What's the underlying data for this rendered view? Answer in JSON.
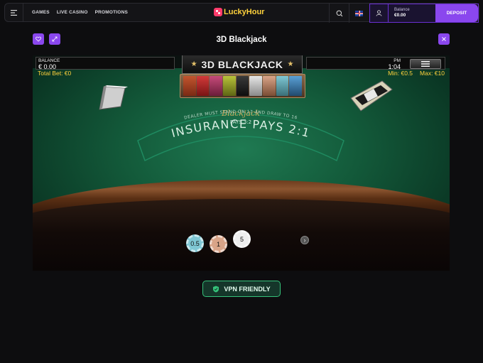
{
  "header": {
    "nav": [
      "GAMES",
      "LIVE CASINO",
      "PROMOTIONS"
    ],
    "logo_text": "LuckyHour",
    "balance_label": "Balance",
    "balance_value": "€0.00",
    "deposit_label": "DEPOSIT"
  },
  "game": {
    "title": "3D Blackjack",
    "table_logo": "3D BLACKJACK",
    "balance_label": "BALANCE",
    "balance_value": "€ 0.00",
    "total_bet": "Total Bet: €0",
    "time_period": "PM",
    "time": "1:04",
    "min_bet": "Min: €0.5",
    "max_bet": "Max: €10",
    "felt_title": "Blackjack",
    "felt_pays": "PAYS 3:2",
    "felt_rule": "DEALER MUST STAND ON 17 AND DRAW TO 16",
    "felt_insurance": "INSURANCE PAYS 2:1",
    "chips": [
      {
        "label": "0.5",
        "color": "#7fc7d4"
      },
      {
        "label": "1",
        "color": "#d9a488"
      },
      {
        "label": "5",
        "color": "#eeeeee"
      }
    ]
  },
  "badge": {
    "label": "VPN FRIENDLY"
  },
  "colors": {
    "accent": "#8a47ee",
    "logo_yellow": "#ffd23c",
    "vpn_green": "#35c27a"
  }
}
